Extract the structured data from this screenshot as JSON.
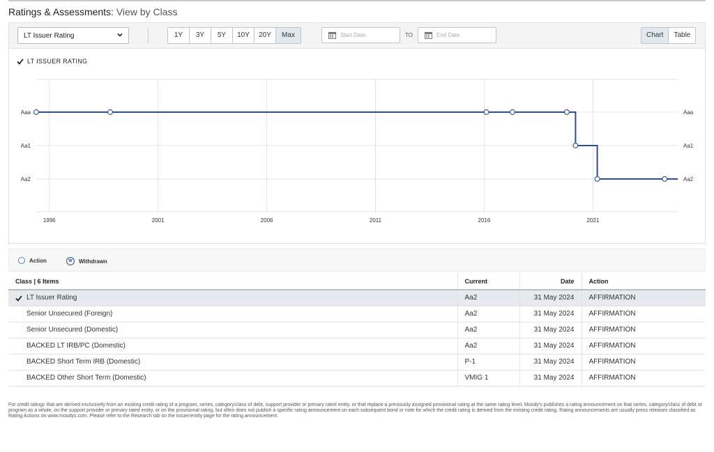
{
  "header": {
    "title": "Ratings & Assessments:",
    "subtitle": "View by Class"
  },
  "toolbar": {
    "rating_select": "LT Issuer Rating",
    "ranges": [
      "1Y",
      "3Y",
      "5Y",
      "10Y",
      "20Y",
      "Max"
    ],
    "active_range": "Max",
    "start_date_placeholder": "Start Date",
    "to_label": "TO",
    "end_date_placeholder": "End Date",
    "view_chart": "Chart",
    "view_table": "Table",
    "active_view": "Chart"
  },
  "chart_data": {
    "type": "line",
    "step": true,
    "title": "LT ISSUER RATING",
    "x_ticks": [
      1996,
      2001,
      2006,
      2011,
      2016,
      2021
    ],
    "xlim": [
      1995.4,
      2024.9
    ],
    "y_categories": [
      "Aaa",
      "Aa1",
      "Aa2"
    ],
    "grid": true,
    "series": [
      {
        "points": [
          {
            "x": 1995.4,
            "y": "Aaa"
          },
          {
            "x": 1998.8,
            "y": "Aaa"
          },
          {
            "x": 2016.1,
            "y": "Aaa"
          },
          {
            "x": 2017.3,
            "y": "Aaa"
          },
          {
            "x": 2019.8,
            "y": "Aaa"
          },
          {
            "x": 2020.2,
            "y": "Aa1"
          },
          {
            "x": 2021.2,
            "y": "Aa2"
          },
          {
            "x": 2024.3,
            "y": "Aa2"
          }
        ],
        "end": {
          "x": 2024.9,
          "y": "Aa2"
        }
      }
    ],
    "color": "#2b4c8f"
  },
  "legend": {
    "action": "Action",
    "withdrawn_glyph": "W",
    "withdrawn": "Withdrawn"
  },
  "table": {
    "headers": {
      "class": "Class | 6 Items",
      "current": "Current",
      "date": "Date",
      "action": "Action"
    },
    "rows": [
      {
        "class": "LT Issuer Rating",
        "current": "Aa2",
        "date": "31 May 2024",
        "action": "AFFIRMATION",
        "selected": true
      },
      {
        "class": "Senior Unsecured (Foreign)",
        "current": "Aa2",
        "date": "31 May 2024",
        "action": "AFFIRMATION"
      },
      {
        "class": "Senior Unsecured (Domestic)",
        "current": "Aa2",
        "date": "31 May 2024",
        "action": "AFFIRMATION"
      },
      {
        "class": "BACKED LT IRB/PC (Domestic)",
        "current": "Aa2",
        "date": "31 May 2024",
        "action": "AFFIRMATION"
      },
      {
        "class": "BACKED Short Term IRB (Domestic)",
        "current": "P-1",
        "date": "31 May 2024",
        "action": "AFFIRMATION"
      },
      {
        "class": "BACKED Other Short Term (Domestic)",
        "current": "VMIG 1",
        "date": "31 May 2024",
        "action": "AFFIRMATION"
      }
    ]
  },
  "footnote": "For credit ratings that are derived exclusively from an existing credit rating of a program, series, category/class of debt, support provider or primary rated entity, or that replace a previously assigned provisional rating at the same rating level, Moody's publishes a rating announcement on that series, category/class of debt or program as a whole, on the support provider or primary rated entity, or on the provisional rating, but often does not publish a specific rating announcement on each subsequent bond or note for which the credit rating is derived from the existing credit rating. Rating announcements are usually press releases classified as Rating Actions on www.moodys.com. Please refer to the Research tab on the issuer/entity page for the rating announcement."
}
